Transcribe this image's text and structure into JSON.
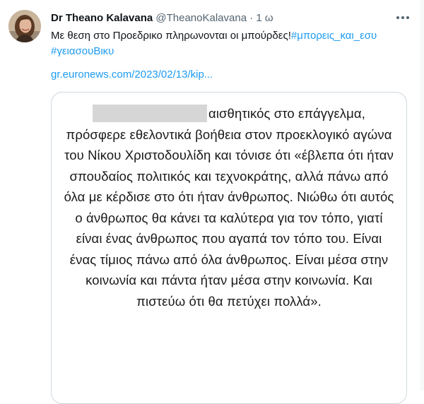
{
  "tweet": {
    "author_name": "Dr Theano Kalavana",
    "handle": "@TheanoKalavana",
    "separator": "·",
    "time": "1 ω",
    "text": "Με θεση στο Προεδρικο πληρωνονται οι μπούρδες!",
    "hashtags": [
      "#μπορεις_και_εσυ",
      "#γειασουΒικυ"
    ],
    "link": "gr.euronews.com/2023/02/13/kip..."
  },
  "card": {
    "article_text": "αισθητικός στο επάγγελμα, πρόσφερε εθελοντικά βοήθεια στον προεκλογικό αγώνα του Νίκου Χριστοδουλίδη και τόνισε ότι «έβλεπα ότι ήταν σπουδαίος πολιτικός και τεχνοκράτης, αλλά πάνω από όλα με κέρδισε στο ότι ήταν άνθρωπος. Νιώθω ότι αυτός ο άνθρωπος θα κάνει τα καλύτερα για τον τόπο, γιατί είναι ένας άνθρωπος που αγαπά τον τόπο του. Είναι ένας τίμιος πάνω από όλα άνθρωπος. Είναι μέσα στην κοινωνία και πάντα ήταν μέσα στην κοινωνία. Και πιστεύω ότι θα πετύχει πολλά»."
  },
  "colors": {
    "accent": "#1d9bf0",
    "text": "#0f1419",
    "muted": "#536471",
    "border": "#cfd9de",
    "redaction": "#d6d6d6"
  },
  "icons": {
    "more": "more-horizontal-icon",
    "avatar": "profile-photo"
  }
}
